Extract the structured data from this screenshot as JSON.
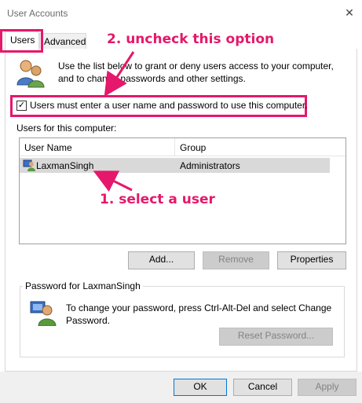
{
  "window": {
    "title": "User Accounts",
    "close_glyph": "✕"
  },
  "tabs": [
    {
      "label": "Users",
      "active": true
    },
    {
      "label": "Advanced",
      "active": false
    }
  ],
  "intro_text": "Use the list below to grant or deny users access to your computer, and to change passwords and other settings.",
  "checkbox": {
    "label": "Users must enter a user name and password to use this computer.",
    "checked": true,
    "check_glyph": "✓"
  },
  "users_caption": "Users for this computer:",
  "table": {
    "columns": [
      "User Name",
      "Group"
    ],
    "rows": [
      {
        "name": "LaxmanSingh",
        "group": "Administrators"
      }
    ]
  },
  "buttons": {
    "add": "Add...",
    "remove": "Remove",
    "properties": "Properties",
    "reset_password": "Reset Password...",
    "ok": "OK",
    "cancel": "Cancel",
    "apply": "Apply"
  },
  "password_group": {
    "label": "Password for LaxmanSingh",
    "text": "To change your password, press Ctrl-Alt-Del and select Change Password."
  },
  "annotations": {
    "step2": "2. uncheck this option",
    "step1": "1. select a user",
    "color": "#e5186b"
  },
  "icons": [
    "users-icon",
    "user-row-icon",
    "password-user-icon",
    "close-icon",
    "checkmark-icon"
  ]
}
